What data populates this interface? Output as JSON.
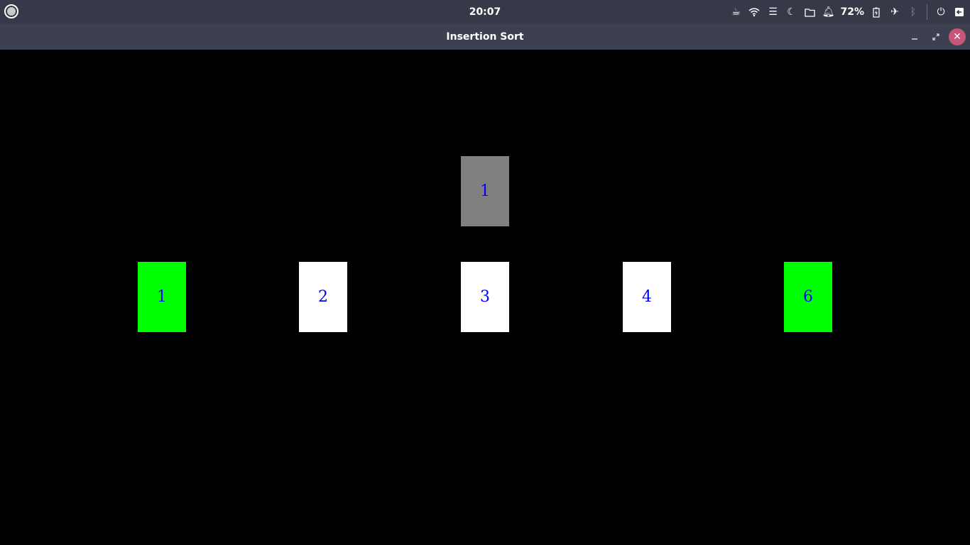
{
  "panel": {
    "clock": "20:07",
    "battery_percent": "72%",
    "icons": [
      "activities-icon",
      "coffee-icon",
      "wifi-icon",
      "menu-icon",
      "night-mode-icon",
      "folder-icon",
      "bell-icon",
      "battery-icon",
      "airplane-mode-icon",
      "bluetooth-icon",
      "power-icon",
      "logout-icon"
    ]
  },
  "window": {
    "title": "Insertion Sort"
  },
  "sort": {
    "held": {
      "value": "1",
      "color": "#808080"
    },
    "array": [
      {
        "value": "1",
        "color": "#00ff00"
      },
      {
        "value": "2",
        "color": "#ffffff"
      },
      {
        "value": "3",
        "color": "#ffffff"
      },
      {
        "value": "4",
        "color": "#ffffff"
      },
      {
        "value": "6",
        "color": "#00ff00"
      }
    ],
    "text_color": "#0000ff"
  }
}
